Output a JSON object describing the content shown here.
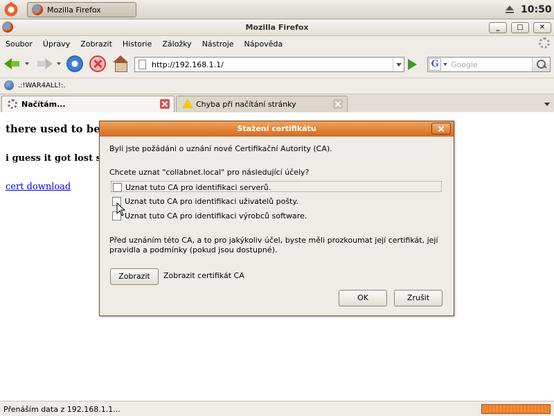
{
  "panel": {
    "task_label": "Mozilla Firefox",
    "clock": "10:50"
  },
  "window": {
    "title": "Mozilla Firefox",
    "minimize": "_",
    "maximize": "□",
    "close": "✕"
  },
  "menu": [
    "Soubor",
    "Úpravy",
    "Zobrazit",
    "Historie",
    "Záložky",
    "Nástroje",
    "Nápověda"
  ],
  "navbar": {
    "url": "http://192.168.1.1/",
    "search_placeholder": "Google",
    "search_engine_letter": "G"
  },
  "bookmarks": {
    "item": ".:!WAR4ALL!:."
  },
  "tabs": [
    {
      "label": "Načítám..."
    },
    {
      "label": "Chyba při načítání stránky"
    }
  ],
  "content": {
    "heading": "there used to be",
    "paragraph": "i guess it got lost sor",
    "link": "cert download"
  },
  "status": {
    "text": "Přenáším data z 192.168.1.1...",
    "progress": 1.0
  },
  "dialog": {
    "title": "Stažení certifikátu",
    "question": "Byli jste požádáni o uznání nové Certifikační Autority (CA).",
    "purpose": "Chcete uznat \"collabnet.local\" pro následující účely?",
    "options": [
      {
        "label": "Uznat tuto CA pro identifikaci serverů.",
        "checked": false
      },
      {
        "label": "Uznat tuto CA pro identifikaci uživatelů pošty.",
        "checked": false
      },
      {
        "label": "Uznat tuto CA pro identifikaci výrobců software.",
        "checked": false
      }
    ],
    "warning": "Před uznáním této CA, a to pro jakýkoliv účel, byste měli prozkoumat její certifikát, její pravidla a podmínky (pokud jsou dostupné).",
    "view_button": "Zobrazit",
    "view_desc": "Zobrazit certifikát CA",
    "ok_button": "OK",
    "cancel_button": "Zrušit"
  }
}
